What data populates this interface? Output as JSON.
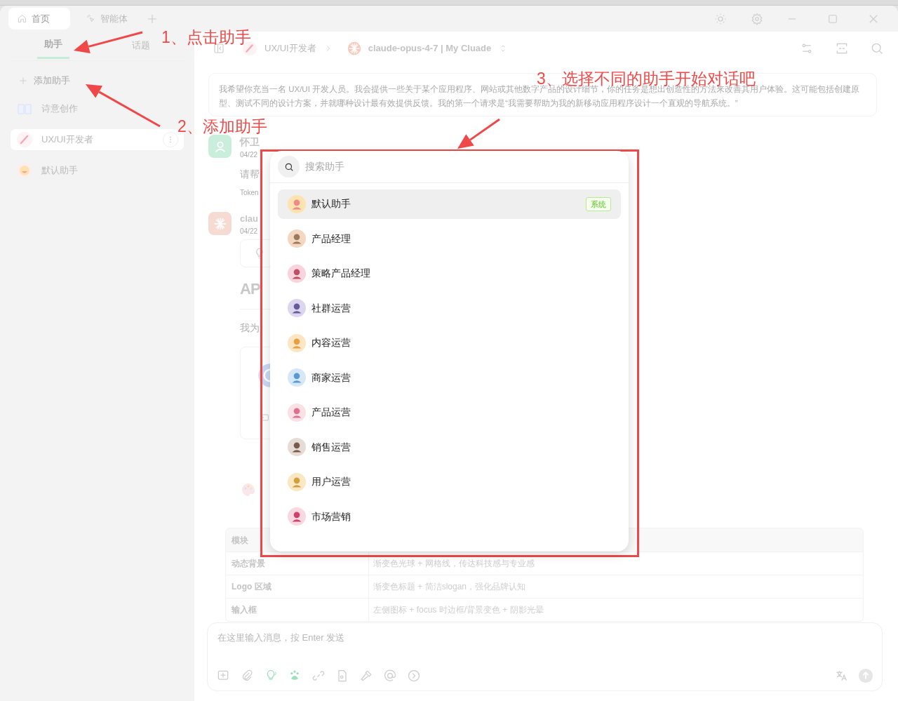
{
  "window": {
    "tabs": [
      {
        "label": "首页",
        "selected": true
      },
      {
        "label": "智能体",
        "selected": false
      }
    ]
  },
  "sidebar": {
    "tabs": [
      {
        "label": "助手",
        "selected": true
      },
      {
        "label": "话题",
        "selected": false
      }
    ],
    "add_label": "添加助手",
    "items": [
      {
        "name": "诗意创作",
        "selected": false
      },
      {
        "name": "UX/UI开发者",
        "selected": true
      },
      {
        "name": "默认助手",
        "selected": false
      }
    ]
  },
  "header": {
    "assistant": "UX/UI开发者",
    "model": "claude-opus-4-7 | My Cluade"
  },
  "prompt": "我希望你充当一名 UX/UI 开发人员。我会提供一些关于某个应用程序、网站或其他数字产品的设计细节，你的任务是想出创造性的方法来改善其用户体验。这可能包括创建原型、测试不同的设计方案，并就哪种设计最有效提供反馈。我的第一个请求是“我需要帮助为我的新移动应用程序设计一个直观的导航系统。”",
  "messages": [
    {
      "kind": "user",
      "author": "怀卫",
      "time": "04/22",
      "text": "请帮",
      "footer": "Token"
    },
    {
      "kind": "assistant",
      "author": "clau",
      "time": "04/22",
      "heading": "AP",
      "text": "我为"
    }
  ],
  "table": {
    "header": "模块",
    "rows": [
      [
        "动态背景",
        "渐变色光球 + 网格线，传达科技感与专业感"
      ],
      [
        "Logo 区域",
        "渐变色标题 + 简洁slogan，强化品牌认知"
      ],
      [
        "输入框",
        "左侧图标 + focus 时边框/背景变色 + 阴影光晕"
      ]
    ]
  },
  "composer": {
    "placeholder": "在这里输入消息，按 Enter 发送"
  },
  "picker": {
    "placeholder": "搜索助手",
    "items": [
      {
        "name": "默认助手",
        "selected": true,
        "badge": "系统"
      },
      {
        "name": "产品经理",
        "selected": false
      },
      {
        "name": "策略产品经理",
        "selected": false
      },
      {
        "name": "社群运营",
        "selected": false
      },
      {
        "name": "内容运营",
        "selected": false
      },
      {
        "name": "商家运营",
        "selected": false
      },
      {
        "name": "产品运营",
        "selected": false
      },
      {
        "name": "销售运营",
        "selected": false
      },
      {
        "name": "用户运营",
        "selected": false
      },
      {
        "name": "市场营销",
        "selected": false
      }
    ]
  },
  "annotations": [
    {
      "text": "1、点击助手"
    },
    {
      "text": "2、添加助手"
    },
    {
      "text": "3、选择不同的助手开始对话吧"
    }
  ]
}
